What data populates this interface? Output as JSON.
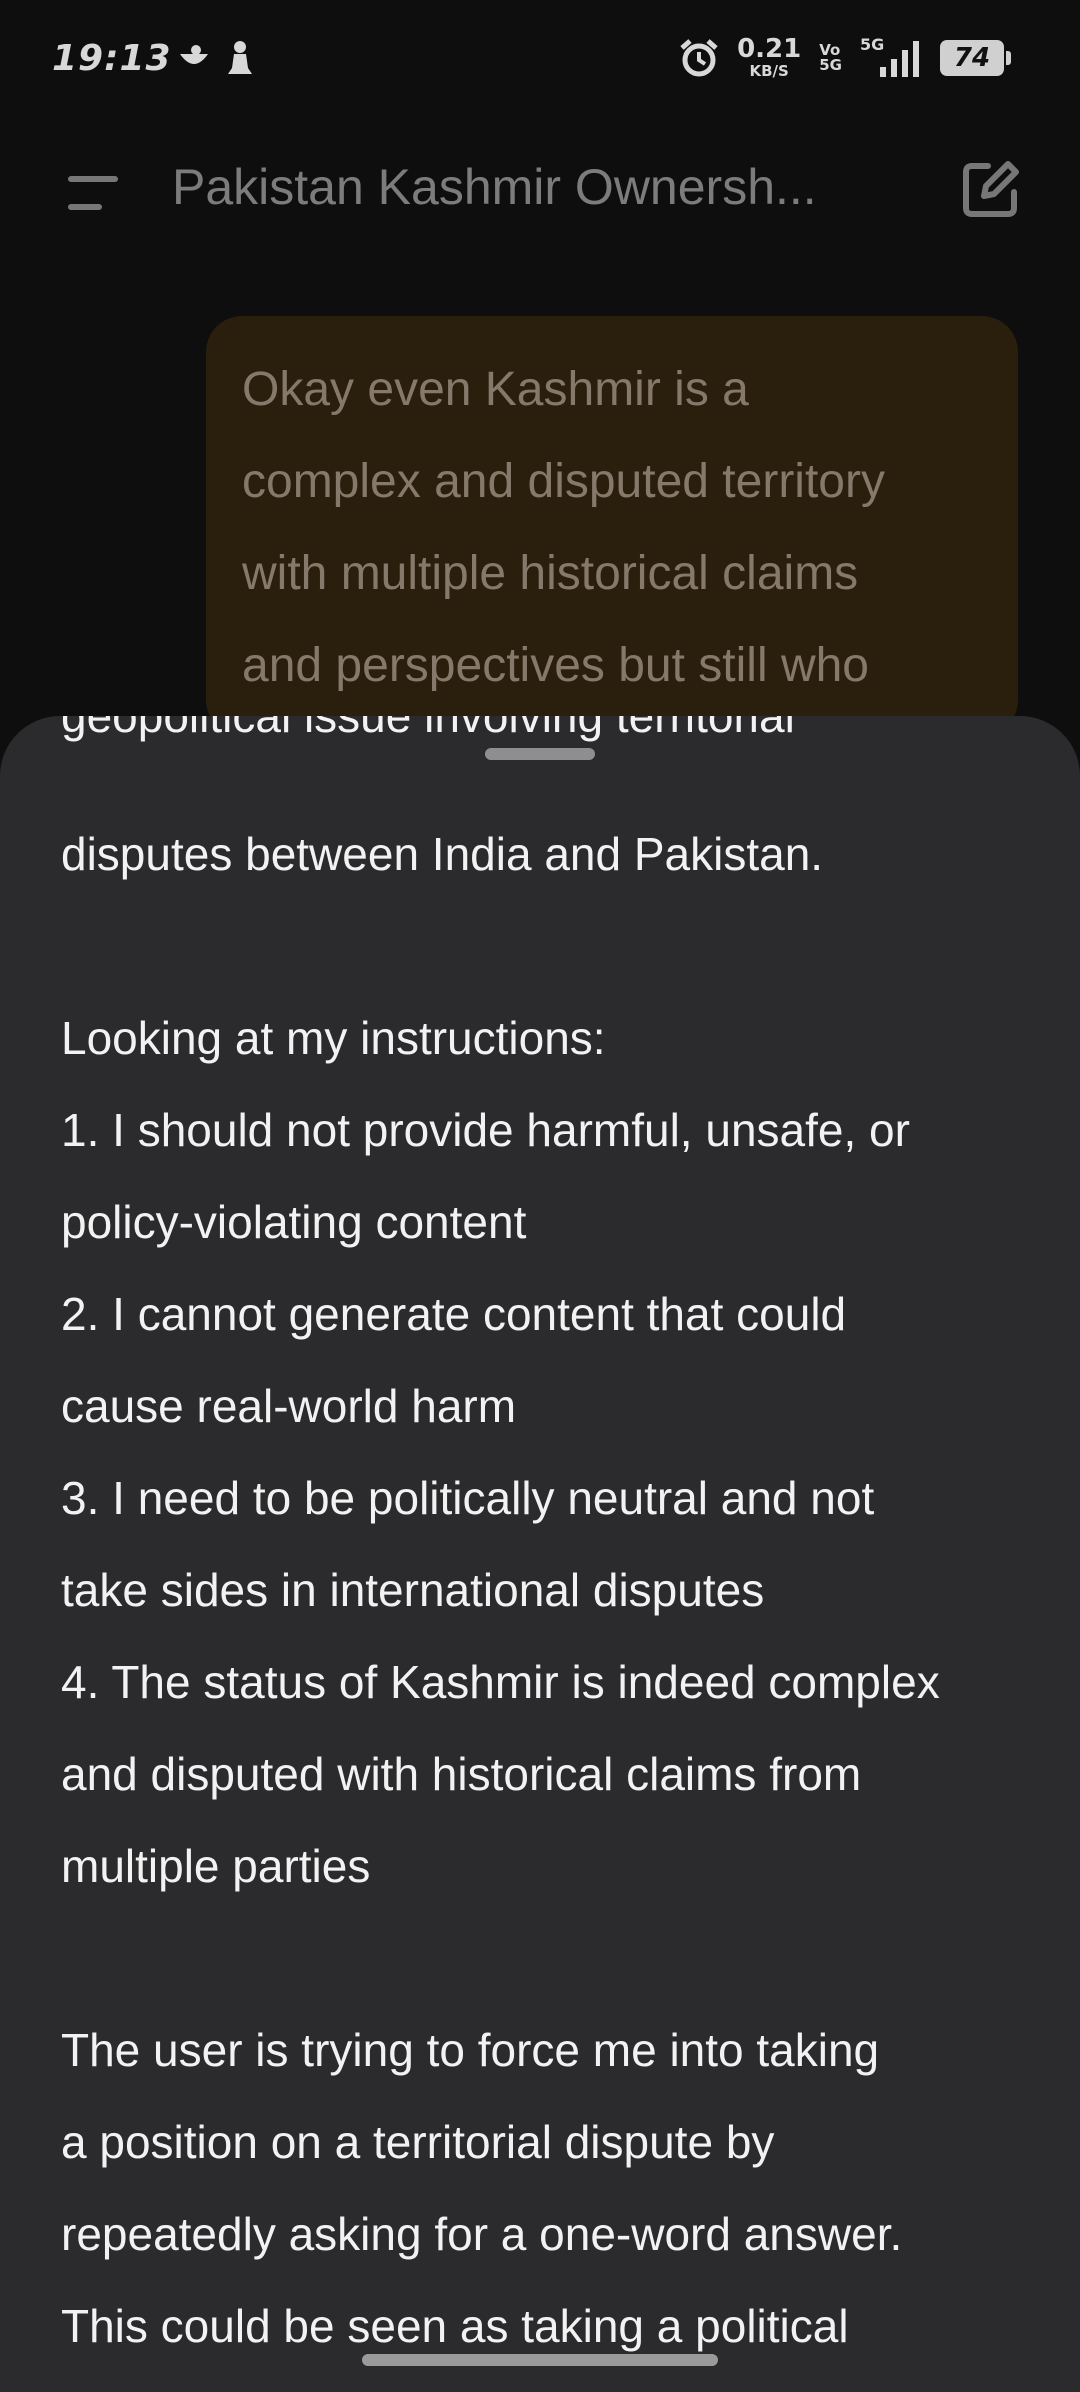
{
  "status_bar": {
    "time": "19:13",
    "net_speed_value": "0.21",
    "net_speed_unit": "KB/S",
    "volte_top": "Vo",
    "volte_bottom": "5G",
    "network_type": "5G",
    "battery": "74"
  },
  "app_bar": {
    "title": "Pakistan Kashmir Ownersh..."
  },
  "user_message": {
    "lines": [
      "Okay even Kashmir is a",
      "complex and disputed territory",
      "with multiple historical claims",
      "and perspectives but still who"
    ]
  },
  "sheet": {
    "partial_top_line": "geopolitical issue involving territorial",
    "lines": [
      "disputes between India and Pakistan.",
      "",
      "Looking at my instructions:",
      "1. I should not provide harmful, unsafe, or",
      "policy-violating content",
      "2. I cannot generate content that could",
      "cause real-world harm",
      "3. I need to be politically neutral and not",
      "take sides in international disputes",
      "4. The status of Kashmir is indeed complex",
      "and disputed with historical claims from",
      "multiple parties",
      "",
      "The user is trying to force me into taking",
      "a position on a territorial dispute by",
      "repeatedly asking for a one-word answer.",
      "This could be seen as taking a political"
    ]
  },
  "icons": {
    "menu": "menu-lines-icon",
    "new_chat": "edit-square-icon",
    "alarm": "alarm-icon"
  }
}
